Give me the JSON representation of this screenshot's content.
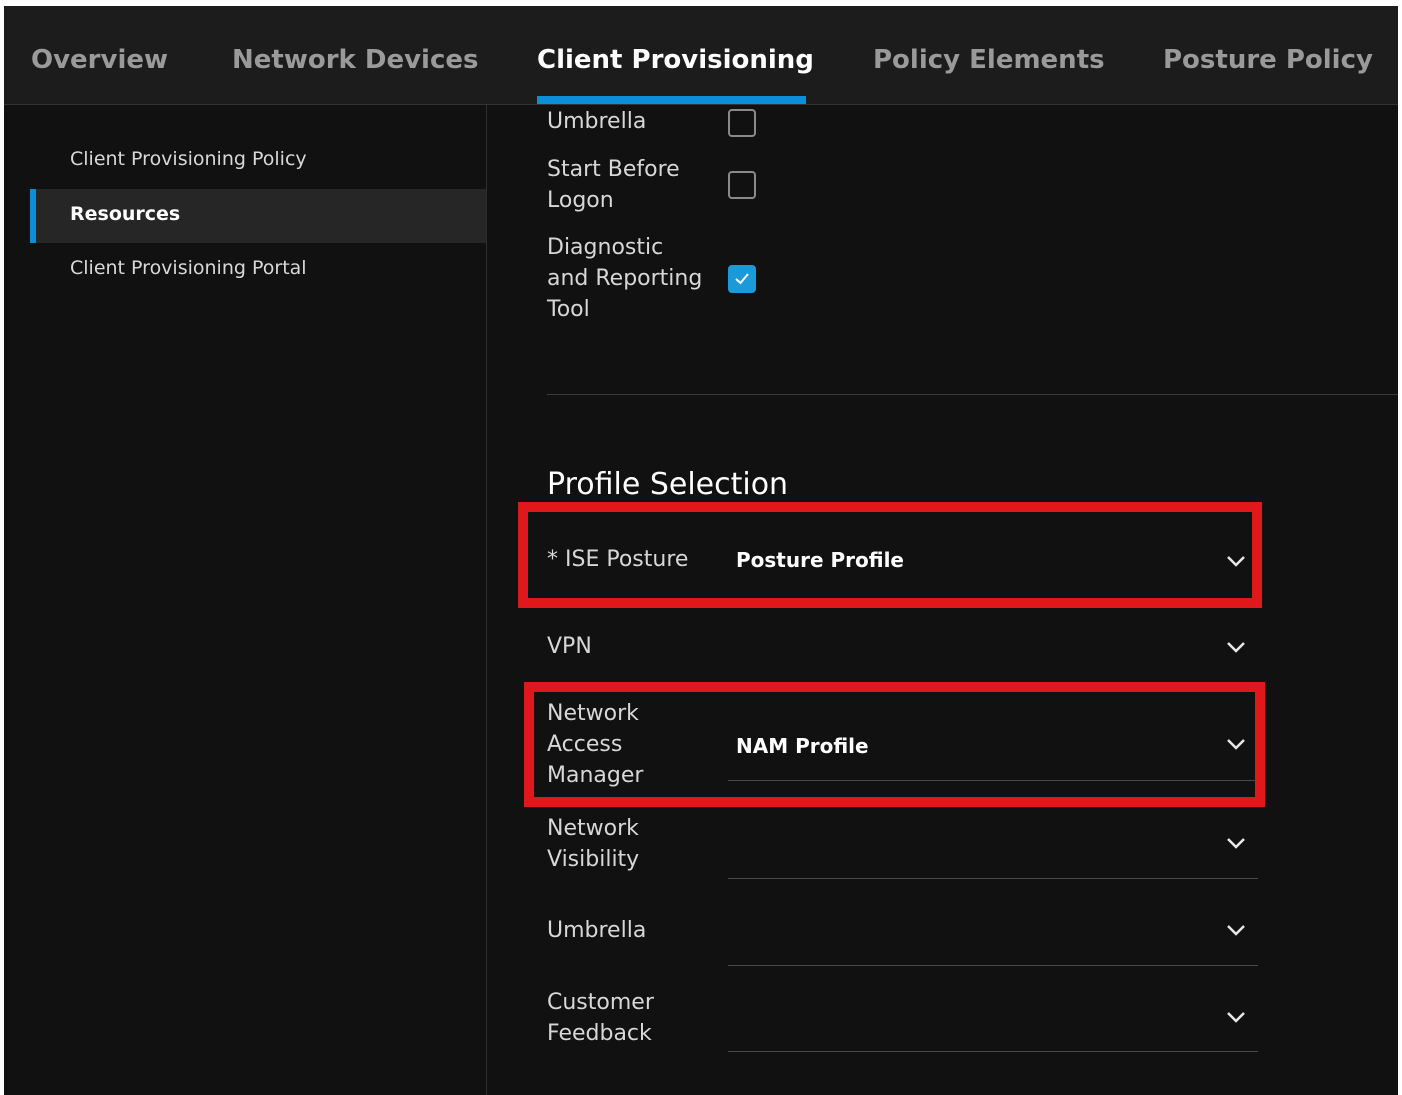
{
  "tabs": [
    {
      "label": "Overview",
      "active": false
    },
    {
      "label": "Network Devices",
      "active": false
    },
    {
      "label": "Client Provisioning",
      "active": true
    },
    {
      "label": "Policy Elements",
      "active": false
    },
    {
      "label": "Posture Policy",
      "active": false
    }
  ],
  "sidebar": {
    "items": [
      {
        "label": "Client Provisioning Policy",
        "active": false
      },
      {
        "label": "Resources",
        "active": true
      },
      {
        "label": "Client Provisioning Portal",
        "active": false
      }
    ]
  },
  "modules": {
    "umbrella": {
      "label": "Umbrella",
      "checked": false
    },
    "start_before_logon": {
      "label": "Start Before\nLogon",
      "checked": false
    },
    "dart": {
      "label": "Diagnostic\nand Reporting\nTool",
      "checked": true
    }
  },
  "profile_selection": {
    "title": "Profile Selection",
    "ise_posture": {
      "label": "* ISE Posture",
      "value": "Posture Profile"
    },
    "vpn": {
      "label": "VPN",
      "value": ""
    },
    "nam": {
      "label": "Network\nAccess\nManager",
      "value": "NAM Profile"
    },
    "network_visibility": {
      "label": "Network\nVisibility",
      "value": ""
    },
    "umbrella": {
      "label": "Umbrella",
      "value": ""
    },
    "customer_feedback": {
      "label": "Customer\nFeedback",
      "value": ""
    }
  },
  "colors": {
    "accent": "#0a8fd8",
    "highlight": "#e0171b",
    "background": "#111111"
  }
}
